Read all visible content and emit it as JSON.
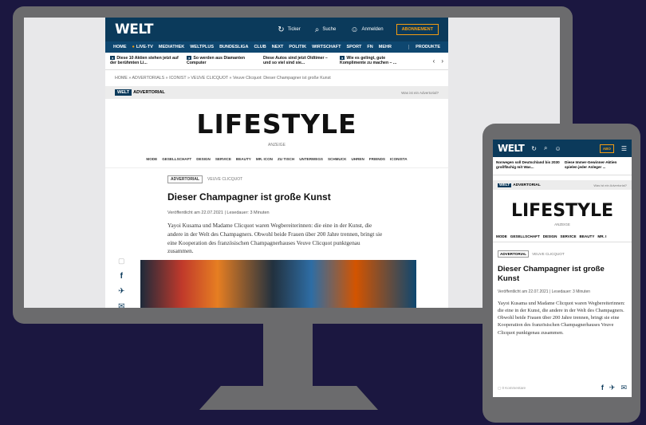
{
  "desktop": {
    "logo": "WELT",
    "topbar": {
      "ticker": "Ticker",
      "search": "Suche",
      "login": "Anmelden",
      "abo": "ABONNEMENT"
    },
    "nav": [
      "HOME",
      "LIVE-TV",
      "MEDIATHEK",
      "WELTPLUS",
      "BUNDESLIGA",
      "CLUB",
      "NEXT",
      "POLITIK",
      "WIRTSCHAFT",
      "SPORT",
      "FN",
      "MEHR"
    ],
    "nav_produkte": "PRODUKTE",
    "ticker_items": [
      "Diese 10 Aktien stehen jetzt auf der berühmten Li...",
      "So werden aus Diamanten Computer",
      "Diese Autos sind jetzt Oldtimer – und so viel sind sie...",
      "Wie es gelingt, gute Komplimente zu machen – ..."
    ],
    "breadcrumb": "HOME » ADVERTORIALS » ICONIST » VEUVE CLICQUOT » Veuve Clicquot: Dieser Champagner ist große Kunst",
    "advertorial_label": "ADVERTORIAL",
    "what_is": "Was ist ein Advertorial?",
    "section_title": "LIFESTYLE",
    "anzeige": "ANZEIGE",
    "categories": [
      "MODE",
      "GESELLSCHAFT",
      "DESIGN",
      "SERVICE",
      "BEAUTY",
      "MR. ICON",
      "ZU TISCH",
      "UNTERWEGS",
      "SCHMUCK",
      "UHREN",
      "FRIENDS",
      "ICONISTA"
    ],
    "tag": "ADVERTORIAL",
    "brand": "VEUVE CLICQUOT",
    "headline": "Dieser Champagner ist große Kunst",
    "date": "Veröffentlicht am 22.07.2021 | Lesedauer: 3 Minuten",
    "lead": "Yayoi Kusama und Madame Clicquot waren Wegbereiterinnen: die eine in der Kunst, die andere in der Welt des Champagners. Obwohl beide Frauen über 200 Jahre trennen, bringt sie eine Kooperation des französischen Champagnerhauses Veuve Clicquot punktgenau zusammen."
  },
  "mobile": {
    "logo": "WELT",
    "abo": "ABO",
    "ticker_items": [
      "Norwegen soll Deutschland bis 2030 großflächig mit Was...",
      "Diese Immer-Gewinner-Aktien spielen jeder Anleger ..."
    ],
    "advertorial_label": "ADVERTORIAL",
    "what_is": "Was ist ein Advertorial?",
    "section_title": "LIFESTYLE",
    "anzeige": "ANZEIGE",
    "categories": [
      "MODE",
      "GESELLSCHAFT",
      "DESIGN",
      "SERVICE",
      "BEAUTY",
      "MR. I"
    ],
    "tag": "ADVERTORIAL",
    "brand": "VEUVE CLICQUOT",
    "headline": "Dieser Champagner ist große Kunst",
    "date": "Veröffentlicht am 22.07.2021 | Lesedauer: 3 Minuten",
    "lead": "Yayoi Kusama und Madame Clicquot waren Wegbereiterinnen: die eine in der Kunst, die andere in der Welt des Champagners. Obwohl beide Frauen über 200 Jahre trennen, bringt sie eine Kooperation des französischen Champagnerhauses Veuve Clicquot punktgenau zusammen.",
    "comments": "0 Kommentare"
  },
  "colors": {
    "welt_blue": "#0b3a5b",
    "accent": "#f39c12",
    "background": "#1b1740",
    "device": "#6b6b6d"
  }
}
